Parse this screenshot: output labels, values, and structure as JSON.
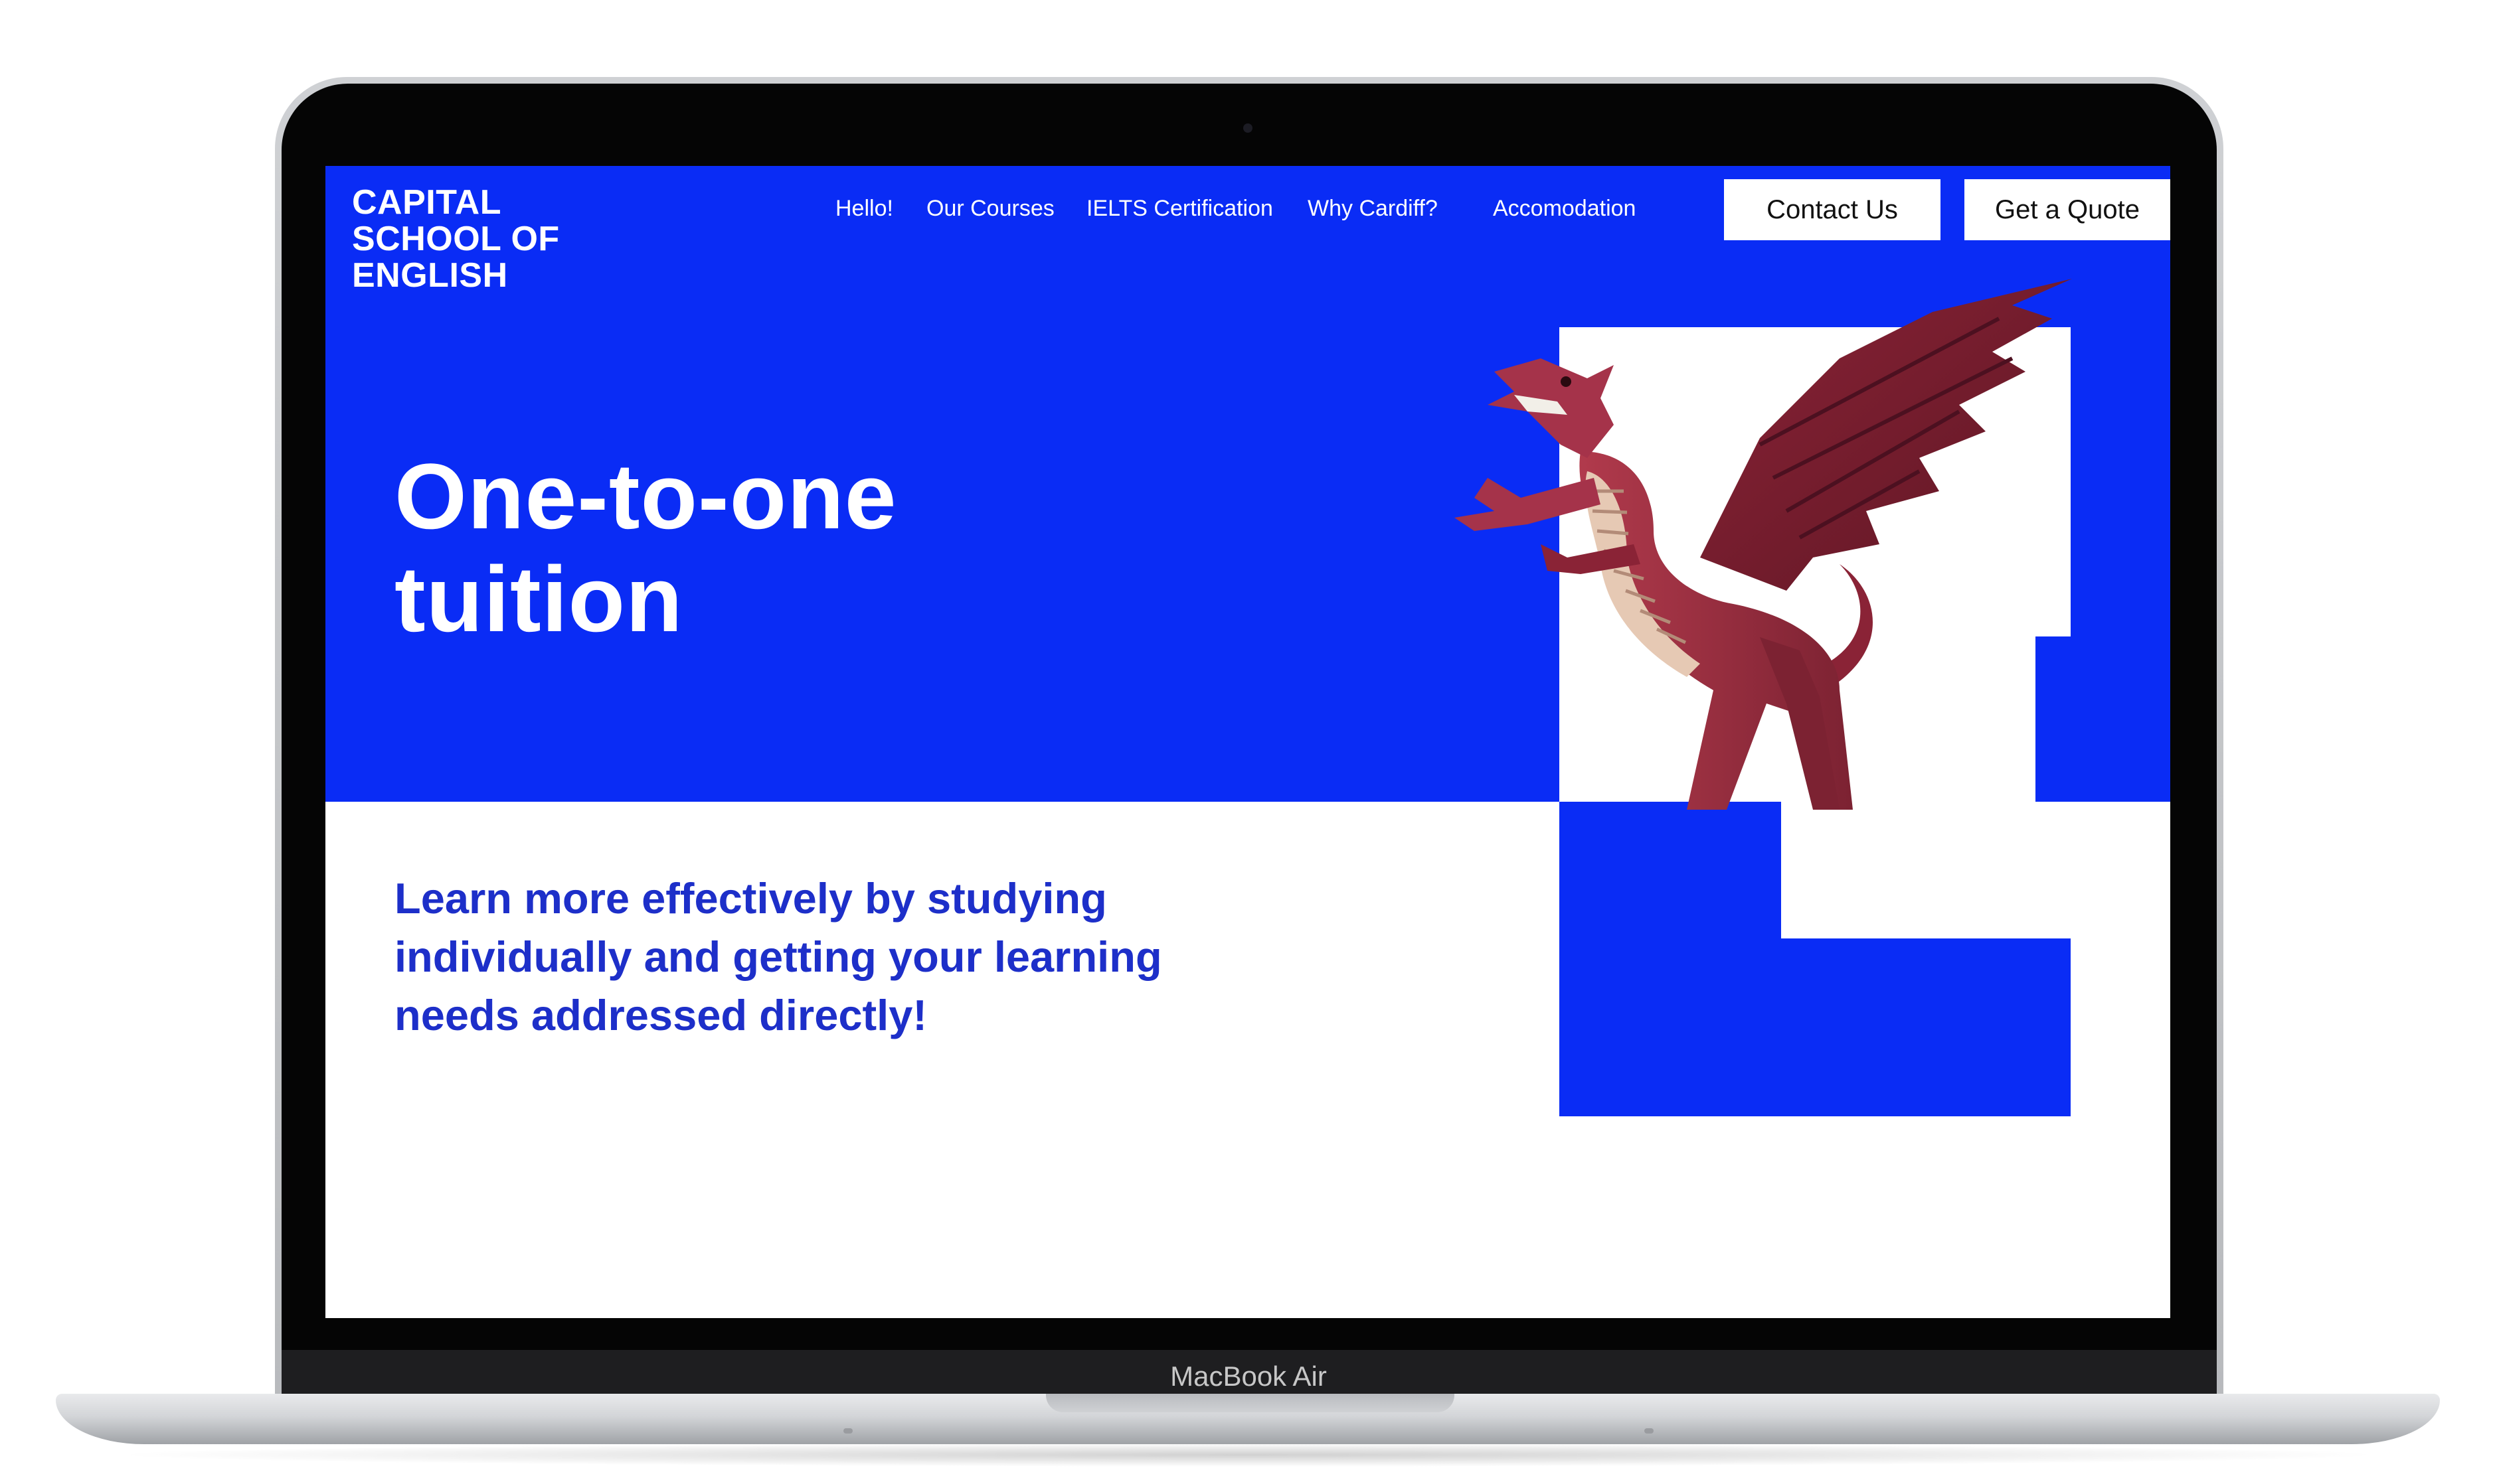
{
  "device": {
    "model_label": "MacBook Air"
  },
  "site": {
    "logo": {
      "line1": "CAPITAL",
      "line2": "SCHOOL OF",
      "line3": "ENGLISH"
    },
    "nav": [
      {
        "label": "Hello!"
      },
      {
        "label": "Our Courses"
      },
      {
        "label": "IELTS Certification"
      },
      {
        "label": "Why Cardiff?"
      },
      {
        "label": "Accomodation"
      }
    ],
    "buttons": {
      "contact": "Contact Us",
      "quote": "Get a Quote"
    },
    "hero": {
      "title_line1": "One-to-one",
      "title_line2": "tuition",
      "subtitle_line1": "Learn more effectively by studying",
      "subtitle_line2": "individually and getting your learning",
      "subtitle_line3": "needs addressed directly!"
    },
    "image": {
      "icon": "red-welsh-dragon"
    }
  },
  "colors": {
    "brand_blue": "#0a2cf5",
    "subtitle_blue": "#1d2fc9",
    "dragon_red": "#9b2a3c",
    "dragon_belly": "#e6c9b4"
  }
}
